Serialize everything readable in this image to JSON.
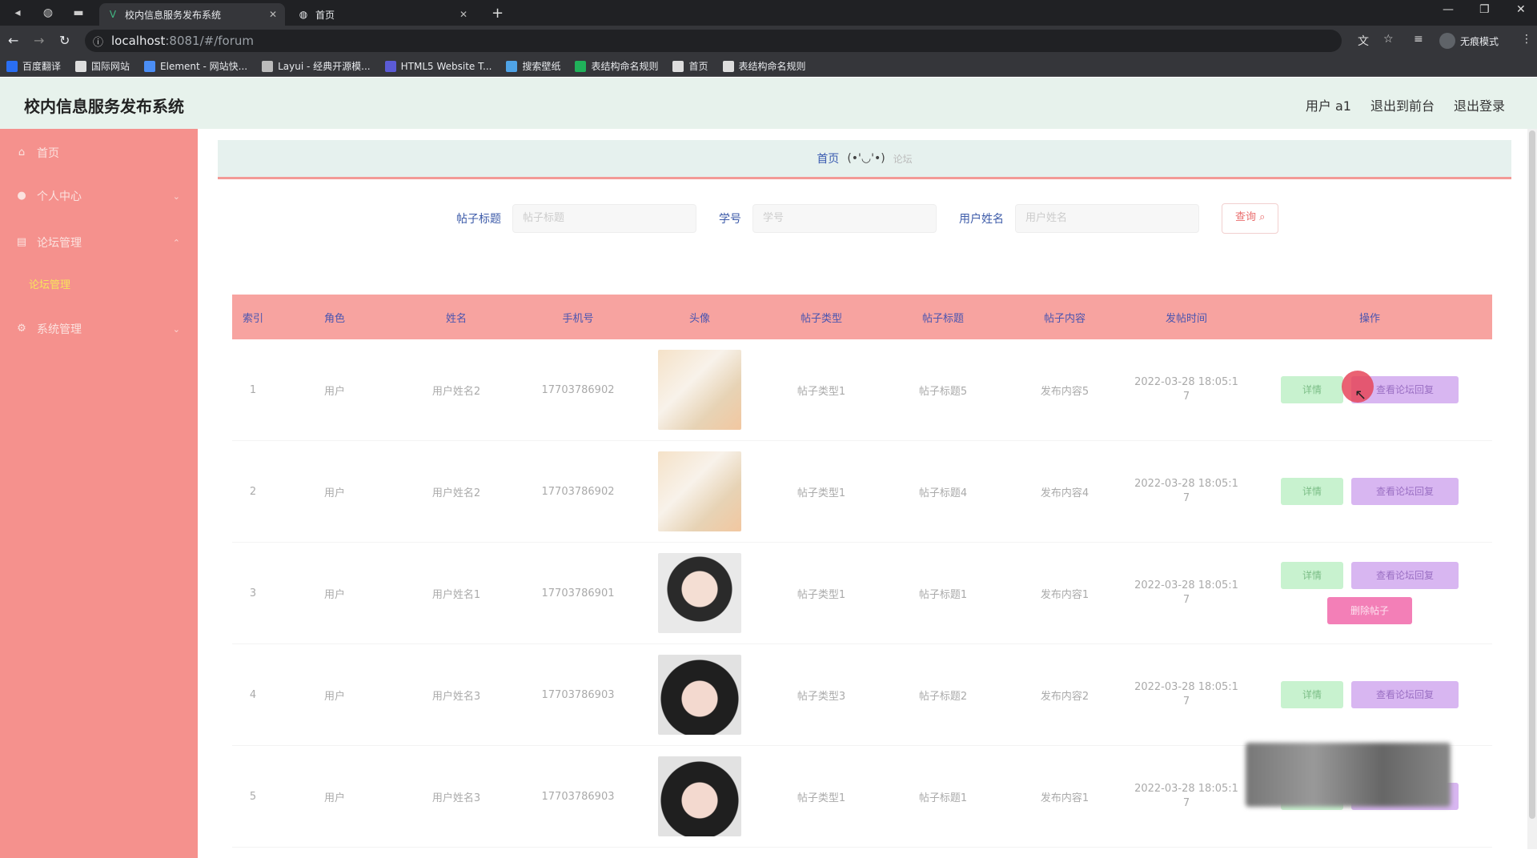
{
  "browser": {
    "tabs": [
      {
        "title": "校内信息服务发布系统",
        "icon": "vue-icon"
      },
      {
        "title": "首页",
        "icon": "globe-icon"
      }
    ],
    "url_host": "localhost",
    "url_rest": ":8081/#/forum",
    "incognito_label": "无痕模式",
    "bookmarks": [
      {
        "label": "百度翻译",
        "color": "#2a6ef2"
      },
      {
        "label": "国际网站",
        "color": "#dddddd"
      },
      {
        "label": "Element - 网站快...",
        "color": "#4b8ef5"
      },
      {
        "label": "Layui - 经典开源模...",
        "color": "#bbbbbb"
      },
      {
        "label": "HTML5 Website T...",
        "color": "#5b5bd6"
      },
      {
        "label": "搜索壁纸",
        "color": "#4fa3e6"
      },
      {
        "label": "表结构命名规则",
        "color": "#20b15a"
      },
      {
        "label": "首页",
        "color": "#dddddd"
      },
      {
        "label": "表结构命名规则",
        "color": "#dddddd"
      }
    ]
  },
  "app": {
    "title": "校内信息服务发布系统",
    "header_links": [
      "用户 a1",
      "退出到前台",
      "退出登录"
    ]
  },
  "sidebar": {
    "items": [
      {
        "label": "首页",
        "icon": "home-icon"
      },
      {
        "label": "个人中心",
        "icon": "user-icon"
      },
      {
        "label": "论坛管理",
        "icon": "forum-icon"
      },
      {
        "label": "系统管理",
        "icon": "settings-icon"
      }
    ],
    "sub_item": "论坛管理"
  },
  "breadcrumb": {
    "home": "首页",
    "face": "(•'◡'•)",
    "current": "论坛"
  },
  "search": {
    "fields": [
      {
        "label": "帖子标题",
        "placeholder": "帖子标题"
      },
      {
        "label": "学号",
        "placeholder": "学号"
      },
      {
        "label": "用户姓名",
        "placeholder": "用户姓名"
      }
    ],
    "button": "查询"
  },
  "table": {
    "headers": [
      "索引",
      "角色",
      "姓名",
      "手机号",
      "头像",
      "帖子类型",
      "帖子标题",
      "帖子内容",
      "发帖时间",
      "操作"
    ],
    "rows": [
      {
        "idx": "1",
        "role": "用户",
        "name": "用户姓名2",
        "phone": "17703786902",
        "type": "帖子类型1",
        "title": "帖子标题5",
        "content": "发布内容5",
        "time": "2022-03-28 18:05:1",
        "time2": "7",
        "image": "img-anime",
        "ops": [
          "详情",
          "查看论坛回复"
        ]
      },
      {
        "idx": "2",
        "role": "用户",
        "name": "用户姓名2",
        "phone": "17703786902",
        "type": "帖子类型1",
        "title": "帖子标题4",
        "content": "发布内容4",
        "time": "2022-03-28 18:05:1",
        "time2": "7",
        "image": "img-anime",
        "ops": [
          "详情",
          "查看论坛回复"
        ]
      },
      {
        "idx": "3",
        "role": "用户",
        "name": "用户姓名1",
        "phone": "17703786901",
        "type": "帖子类型1",
        "title": "帖子标题1",
        "content": "发布内容1",
        "time": "2022-03-28 18:05:1",
        "time2": "7",
        "image": "img-girl",
        "ops": [
          "详情",
          "查看论坛回复",
          "删除帖子"
        ]
      },
      {
        "idx": "4",
        "role": "用户",
        "name": "用户姓名3",
        "phone": "17703786903",
        "type": "帖子类型3",
        "title": "帖子标题2",
        "content": "发布内容2",
        "time": "2022-03-28 18:05:1",
        "time2": "7",
        "image": "img-girl2",
        "ops": [
          "详情",
          "查看论坛回复"
        ]
      },
      {
        "idx": "5",
        "role": "用户",
        "name": "用户姓名3",
        "phone": "17703786903",
        "type": "帖子类型1",
        "title": "帖子标题1",
        "content": "发布内容1",
        "time": "2022-03-28 18:05:1",
        "time2": "7",
        "image": "img-girl2",
        "ops": [
          "详情",
          "查看论坛回复"
        ]
      }
    ]
  }
}
